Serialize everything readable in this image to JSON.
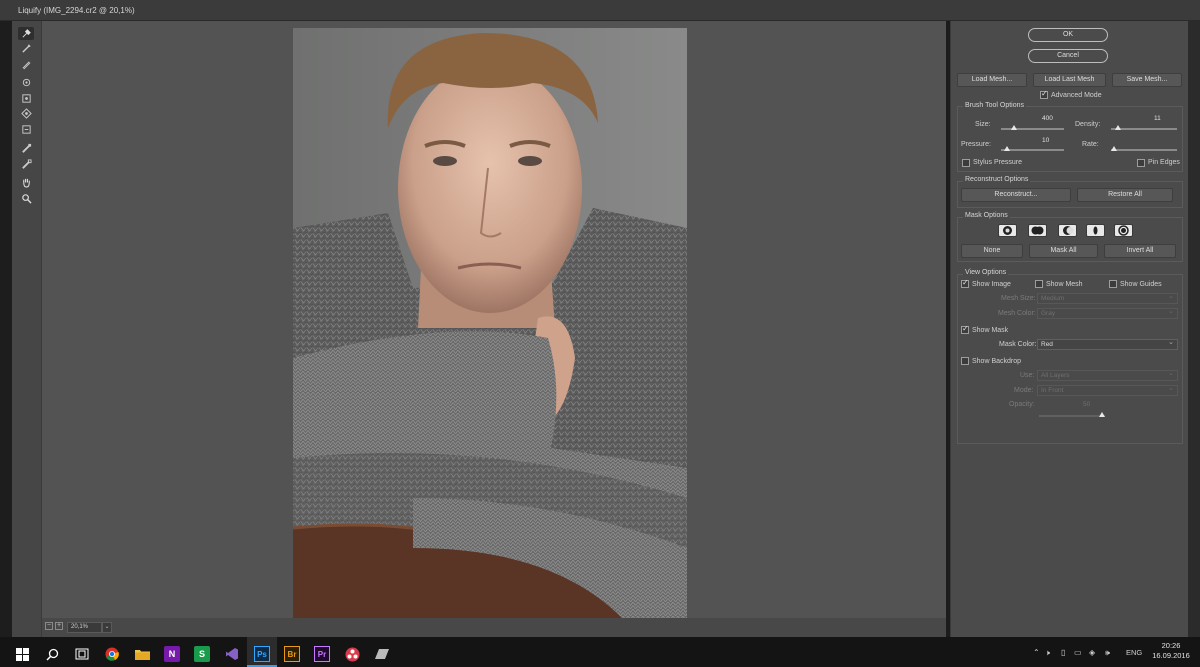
{
  "window": {
    "title": "Liquify (IMG_2294.cr2 @ 20,1%)"
  },
  "tools": [
    {
      "name": "forward-warp-tool-icon"
    },
    {
      "name": "reconstruct-tool-icon"
    },
    {
      "name": "smooth-tool-icon"
    },
    {
      "name": "twirl-clockwise-tool-icon"
    },
    {
      "name": "pucker-tool-icon"
    },
    {
      "name": "bloat-tool-icon"
    },
    {
      "name": "push-left-tool-icon"
    },
    {
      "name": "freeze-mask-tool-icon"
    },
    {
      "name": "thaw-mask-tool-icon"
    },
    {
      "name": "hand-tool-icon"
    },
    {
      "name": "zoom-tool-icon"
    }
  ],
  "status": {
    "zoom": "20,1%"
  },
  "panel": {
    "ok": "OK",
    "cancel": "Cancel",
    "load_mesh": "Load Mesh...",
    "load_last_mesh": "Load Last Mesh",
    "save_mesh": "Save Mesh...",
    "advanced_mode": "Advanced Mode",
    "brush": {
      "title": "Brush Tool Options",
      "size_label": "Size:",
      "size_value": "400",
      "size_level": 0.22,
      "density_label": "Density:",
      "density_value": "11",
      "density_level": 0.1,
      "pressure_label": "Pressure:",
      "pressure_value": "10",
      "pressure_level": 0.1,
      "rate_label": "Rate:",
      "rate_level": 0.05,
      "stylus_pressure": "Stylus Pressure",
      "pin_edges": "Pin Edges"
    },
    "reconstruct": {
      "title": "Reconstruct Options",
      "reconstruct_btn": "Reconstruct...",
      "restore_all": "Restore All"
    },
    "mask": {
      "title": "Mask Options",
      "none": "None",
      "mask_all": "Mask All",
      "invert_all": "Invert All"
    },
    "view": {
      "title": "View Options",
      "show_image": "Show Image",
      "show_mesh": "Show Mesh",
      "show_guides": "Show Guides",
      "mesh_size_label": "Mesh Size:",
      "mesh_size_value": "Medium",
      "mesh_color_label": "Mesh Color:",
      "mesh_color_value": "Gray",
      "show_mask": "Show Mask",
      "mask_color_label": "Mask Color:",
      "mask_color_value": "Red",
      "show_backdrop": "Show Backdrop",
      "use_label": "Use:",
      "use_value": "All Layers",
      "mode_label": "Mode:",
      "mode_value": "In Front",
      "opacity_label": "Opacity:",
      "opacity_value": "50",
      "opacity_level": 0.5
    }
  },
  "taskbar": {
    "apps": [
      {
        "name": "windows-start-icon",
        "glyph": "⊞"
      },
      {
        "name": "search-icon",
        "glyph": ""
      },
      {
        "name": "task-view-icon",
        "glyph": ""
      },
      {
        "name": "chrome-icon",
        "glyph": ""
      },
      {
        "name": "file-explorer-icon",
        "glyph": ""
      },
      {
        "name": "onenote-icon",
        "glyph": "N"
      },
      {
        "name": "skype-app-icon",
        "glyph": "S"
      },
      {
        "name": "visual-studio-icon",
        "glyph": ""
      },
      {
        "name": "photoshop-icon",
        "glyph": "Ps"
      },
      {
        "name": "bridge-icon",
        "glyph": "Br"
      },
      {
        "name": "premiere-icon",
        "glyph": "Pr"
      },
      {
        "name": "davinci-resolve-icon",
        "glyph": ""
      },
      {
        "name": "eraser-app-icon",
        "glyph": ""
      }
    ],
    "language": "ENG",
    "time": "20:26",
    "date": "16.09.2016"
  },
  "colors": {
    "accent": "#3e9be0",
    "panel": "#4b4b4b",
    "canvas": "#535353",
    "mask_red": "#d03030"
  }
}
